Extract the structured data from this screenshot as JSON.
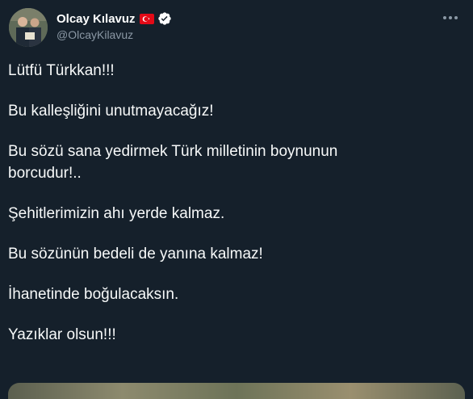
{
  "tweet": {
    "author": {
      "display_name": "Olcay Kılavuz",
      "handle": "@OlcayKilavuz",
      "flag_icon": "turkey-flag-icon",
      "verified_icon": "verified-badge-icon",
      "avatar_icon": "avatar"
    },
    "more_icon": "more-options-icon",
    "paragraphs": [
      "Lütfü Türkkan!!!",
      "Bu kalleşliğini unutmayacağız!",
      "Bu sözü sana yedirmek Türk milletinin boynunun\nborcudur!..",
      "Şehitlerimizin ahı yerde kalmaz.",
      "Bu sözünün bedeli de yanına kalmaz!",
      "İhanetinde boğulacaksın.",
      "Yazıklar olsun!!!"
    ]
  },
  "colors": {
    "background": "#15202b",
    "text": "#f7f9f9",
    "secondary_text": "#8b98a5",
    "verified": "#1d9bf0",
    "flag_red": "#e30a17"
  }
}
